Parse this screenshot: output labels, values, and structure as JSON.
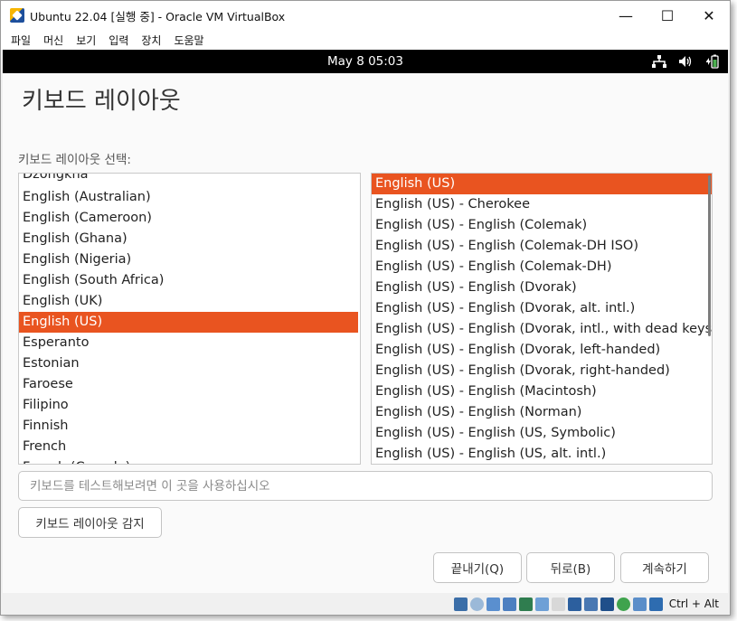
{
  "window": {
    "title": "Ubuntu 22.04 [실행 중] - Oracle VM VirtualBox",
    "minimize": "—",
    "maximize": "☐",
    "close": "✕"
  },
  "menu": [
    "파일",
    "머신",
    "보기",
    "입력",
    "장치",
    "도움말"
  ],
  "guest": {
    "clock": "May 8  05:03",
    "page_title": "키보드 레이아웃",
    "section_label": "키보드 레이아웃 선택:",
    "left_list": {
      "items": [
        "Dzongkha",
        "English (Australian)",
        "English (Cameroon)",
        "English (Ghana)",
        "English (Nigeria)",
        "English (South Africa)",
        "English (UK)",
        "English (US)",
        "Esperanto",
        "Estonian",
        "Faroese",
        "Filipino",
        "Finnish",
        "French",
        "French (Canada)"
      ],
      "selected": "English (US)"
    },
    "right_list": {
      "items": [
        "English (US)",
        "English (US) - Cherokee",
        "English (US) - English (Colemak)",
        "English (US) - English (Colemak-DH ISO)",
        "English (US) - English (Colemak-DH)",
        "English (US) - English (Dvorak)",
        "English (US) - English (Dvorak, alt. intl.)",
        "English (US) - English (Dvorak, intl., with dead keys)",
        "English (US) - English (Dvorak, left-handed)",
        "English (US) - English (Dvorak, right-handed)",
        "English (US) - English (Macintosh)",
        "English (US) - English (Norman)",
        "English (US) - English (US, Symbolic)",
        "English (US) - English (US, alt. intl.)"
      ],
      "selected": "English (US)"
    },
    "test_placeholder": "키보드를 테스트해보려면 이 곳을 사용하십시오",
    "detect_button": "키보드 레이아웃 감지",
    "quit_button": "끝내기(Q)",
    "back_button": "뒤로(B)",
    "continue_button": "계속하기"
  },
  "statusbar": {
    "host_key": "Ctrl + Alt",
    "icons": [
      "hard-disk-icon",
      "optical-drive-icon",
      "audio-icon",
      "network-icon",
      "usb-icon",
      "shared-folders-icon",
      "display-icon",
      "screen-capture-icon",
      "video-capture-icon",
      "recording-icon",
      "guest-additions-icon",
      "mouse-integration-icon",
      "keyboard-capture-icon"
    ]
  },
  "colors": {
    "accent": "#e95420",
    "topbar": "#000000"
  }
}
